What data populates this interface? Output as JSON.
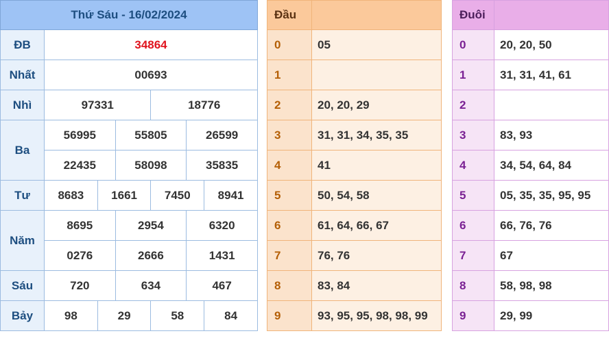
{
  "header": {
    "title": "Thứ Sáu - 16/02/2024"
  },
  "prizes": {
    "db": {
      "label": "ĐB",
      "values": [
        "34864"
      ]
    },
    "nhat": {
      "label": "Nhất",
      "values": [
        "00693"
      ]
    },
    "nhi": {
      "label": "Nhì",
      "values": [
        "97331",
        "18776"
      ]
    },
    "ba": {
      "label": "Ba",
      "values": [
        "56995",
        "55805",
        "26599",
        "22435",
        "58098",
        "35835"
      ]
    },
    "tu": {
      "label": "Tư",
      "values": [
        "8683",
        "1661",
        "7450",
        "8941"
      ]
    },
    "nam": {
      "label": "Năm",
      "values": [
        "8695",
        "2954",
        "6320",
        "0276",
        "2666",
        "1431"
      ]
    },
    "sau": {
      "label": "Sáu",
      "values": [
        "720",
        "634",
        "467"
      ]
    },
    "bay": {
      "label": "Bảy",
      "values": [
        "98",
        "29",
        "58",
        "84"
      ]
    }
  },
  "dau": {
    "title": "Đầu",
    "rows": [
      {
        "k": "0",
        "v": "05"
      },
      {
        "k": "1",
        "v": ""
      },
      {
        "k": "2",
        "v": "20, 20, 29"
      },
      {
        "k": "3",
        "v": "31, 31, 34, 35, 35"
      },
      {
        "k": "4",
        "v": "41"
      },
      {
        "k": "5",
        "v": "50, 54, 58"
      },
      {
        "k": "6",
        "v": "61, 64, 66, 67"
      },
      {
        "k": "7",
        "v": "76, 76"
      },
      {
        "k": "8",
        "v": "83, 84"
      },
      {
        "k": "9",
        "v": "93, 95, 95, 98, 98, 99"
      }
    ]
  },
  "duoi": {
    "title": "Đuôi",
    "rows": [
      {
        "k": "0",
        "v": "20, 20, 50"
      },
      {
        "k": "1",
        "v": "31, 31, 41, 61"
      },
      {
        "k": "2",
        "v": ""
      },
      {
        "k": "3",
        "v": "83, 93"
      },
      {
        "k": "4",
        "v": "34, 54, 64, 84"
      },
      {
        "k": "5",
        "v": "05, 35, 35, 95, 95"
      },
      {
        "k": "6",
        "v": "66, 76, 76"
      },
      {
        "k": "7",
        "v": "67"
      },
      {
        "k": "8",
        "v": "58, 98, 98"
      },
      {
        "k": "9",
        "v": "29, 99"
      }
    ]
  }
}
